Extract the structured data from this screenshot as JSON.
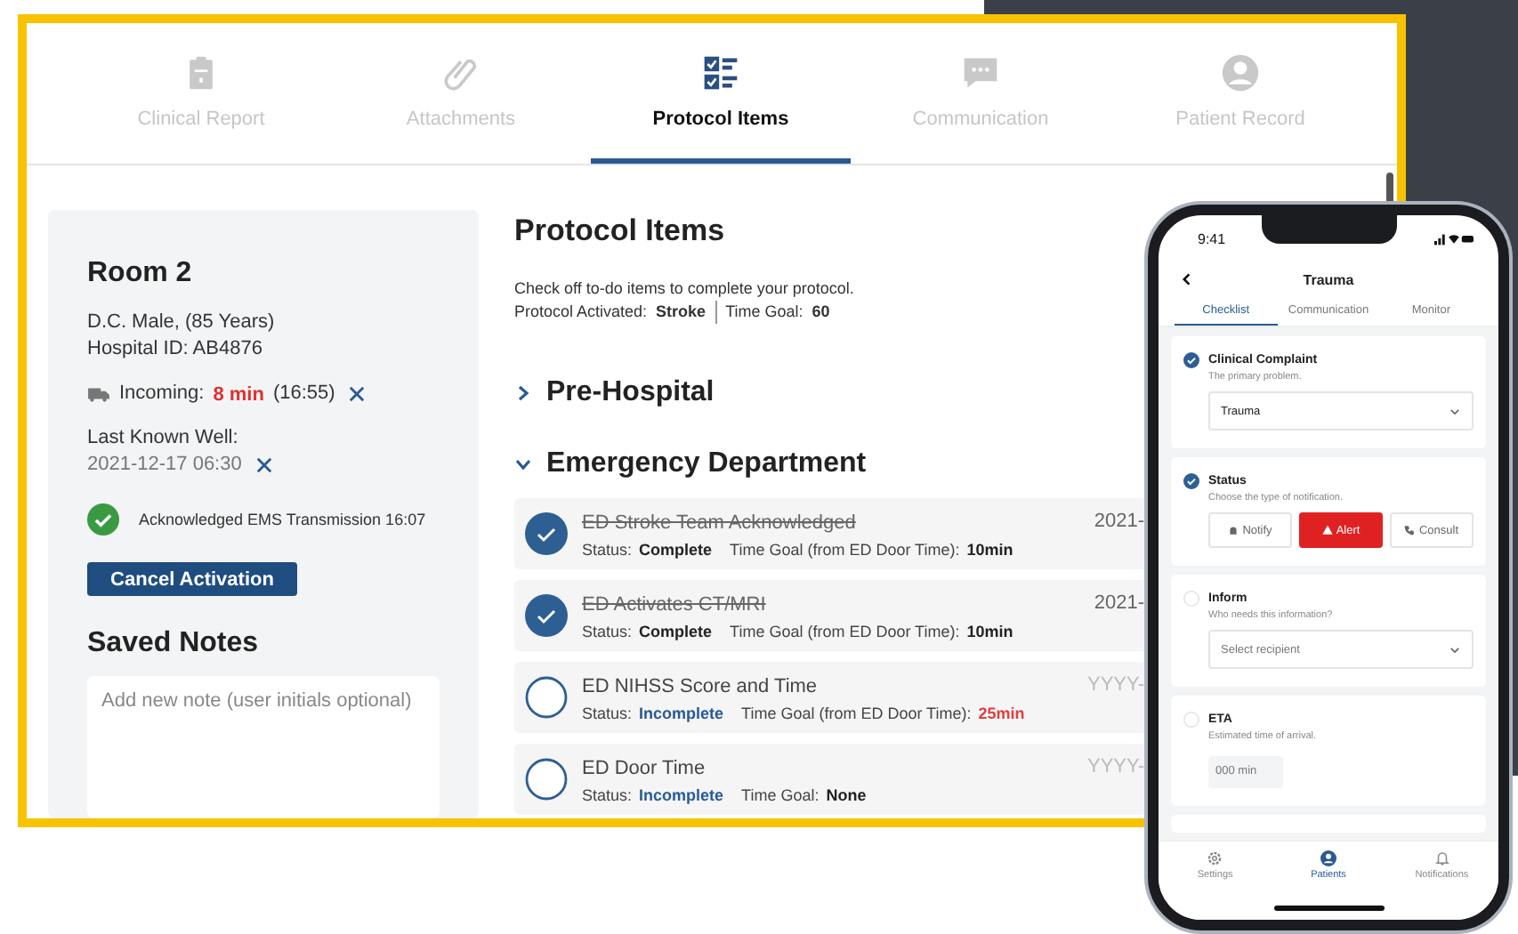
{
  "tabs": [
    {
      "label": "Clinical Report",
      "selected": false
    },
    {
      "label": "Attachments",
      "selected": false
    },
    {
      "label": "Protocol Items",
      "selected": true
    },
    {
      "label": "Communication",
      "selected": false
    },
    {
      "label": "Patient Record",
      "selected": false
    }
  ],
  "patient": {
    "room": "Room 2",
    "description": "D.C. Male, (85 Years)",
    "hospital_id": "Hospital ID: AB4876",
    "incoming_label": "Incoming:",
    "incoming_eta": "8 min",
    "incoming_time": "(16:55)",
    "lkw_label": "Last Known Well:",
    "lkw_value": "2021-12-17 06:30",
    "acknowledgement": "Acknowledged EMS Transmission 16:07",
    "cancel_button": "Cancel Activation",
    "notes_title": "Saved Notes",
    "notes_placeholder": "Add new note (user initials optional)"
  },
  "protocol": {
    "title": "Protocol Items",
    "instructions": "Check off to-do items to complete your protocol.",
    "activated_label": "Protocol Activated:",
    "activated_value": "Stroke",
    "goal_label": "Time Goal:",
    "goal_value": "60",
    "sections": [
      {
        "title": "Pre-Hospital",
        "expanded": false
      },
      {
        "title": "Emergency Department",
        "expanded": true,
        "items": [
          {
            "name": "ED Stroke Team Acknowledged",
            "checked": true,
            "status_label": "Status:",
            "status": "Complete",
            "goal_label": "Time Goal (from ED Door Time):",
            "goal": "10min",
            "overdue": false,
            "date": "2021-"
          },
          {
            "name": "ED Activates CT/MRI",
            "checked": true,
            "status_label": "Status:",
            "status": "Complete",
            "goal_label": "Time Goal (from ED Door Time):",
            "goal": "10min",
            "overdue": false,
            "date": "2021-"
          },
          {
            "name": "ED NIHSS Score and Time",
            "checked": false,
            "status_label": "Status:",
            "status": "Incomplete",
            "goal_label": "Time Goal (from ED Door Time):",
            "goal": "25min",
            "overdue": true,
            "date": "YYYY-"
          },
          {
            "name": "ED Door Time",
            "checked": false,
            "status_label": "Status:",
            "status": "Incomplete",
            "goal_label": "Time Goal:",
            "goal": "None",
            "overdue": false,
            "date": "YYYY-"
          }
        ]
      }
    ]
  },
  "phone": {
    "time": "9:41",
    "title": "Trauma",
    "tabs": [
      {
        "label": "Checklist",
        "selected": true
      },
      {
        "label": "Communication",
        "selected": false
      },
      {
        "label": "Monitor",
        "selected": false
      }
    ],
    "cards": [
      {
        "kind": "select",
        "title": "Clinical Complaint",
        "subtitle": "The primary problem.",
        "checked": true,
        "value": "Trauma"
      },
      {
        "kind": "buttons",
        "title": "Status",
        "subtitle": "Choose the type of notification.",
        "checked": true,
        "buttons": [
          {
            "label": "Notify",
            "selected": false
          },
          {
            "label": "Alert",
            "selected": true
          },
          {
            "label": "Consult",
            "selected": false
          }
        ]
      },
      {
        "kind": "select",
        "title": "Inform",
        "subtitle": "Who needs this information?",
        "checked": false,
        "placeholder": "Select recipient"
      },
      {
        "kind": "input",
        "title": "ETA",
        "subtitle": "Estimated time of arrival.",
        "checked": false,
        "placeholder": "000 min"
      }
    ],
    "nav": [
      {
        "label": "Settings",
        "selected": false
      },
      {
        "label": "Patients",
        "selected": true
      },
      {
        "label": "Notifications",
        "selected": false
      }
    ]
  }
}
